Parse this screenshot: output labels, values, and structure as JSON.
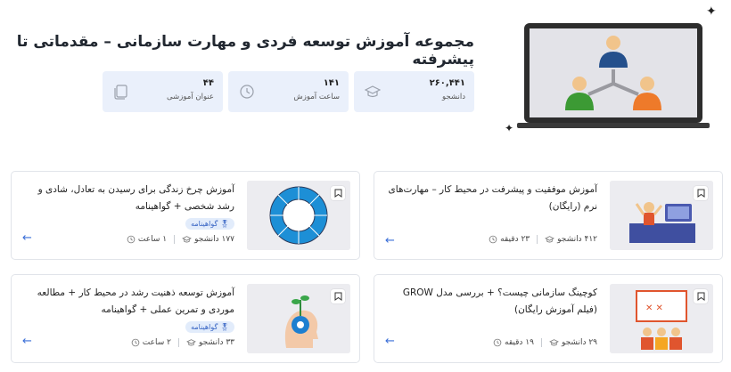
{
  "page": {
    "title": "مجموعه آموزش توسعه فردی و مهارت سازمانی – مقدماتی تا پیشرفته"
  },
  "stats": [
    {
      "value": "۲۶۰,۴۴۱",
      "label": "دانشجو",
      "icon": "graduation-cap-icon"
    },
    {
      "value": "۱۴۱",
      "label": "ساعت آموزش",
      "icon": "clock-icon"
    },
    {
      "value": "۴۴",
      "label": "عنوان آموزشی",
      "icon": "book-icon"
    }
  ],
  "courses": [
    {
      "title": "آموزش موفقیت و پیشرفت در محیط کار – مهارت‌های نرم (رایگان)",
      "students": "۴۱۲ دانشجو",
      "duration": "۲۳ دقیقه",
      "badge": ""
    },
    {
      "title": "آموزش چرخ زندگی برای رسیدن به تعادل، شادی و رشد شخصی + گواهینامه",
      "students": "۱۷۷ دانشجو",
      "duration": "۱ ساعت",
      "badge": "گواهینامه"
    },
    {
      "title": "کوچینگ سازمانی چیست؟ + بررسی مدل GROW (فیلم آموزش رایگان)",
      "students": "۲۹ دانشجو",
      "duration": "۱۹ دقیقه",
      "badge": ""
    },
    {
      "title": "آموزش توسعه ذهنیت رشد در محیط کار + مطالعه موردی و تمرین عملی + گواهینامه",
      "students": "۳۳ دانشجو",
      "duration": "۲ ساعت",
      "badge": "گواهینامه"
    }
  ],
  "colors": {
    "accent": "#3b6fd8",
    "stat_bg": "#eaf0fb",
    "badge_bg": "#e2ecfb"
  }
}
